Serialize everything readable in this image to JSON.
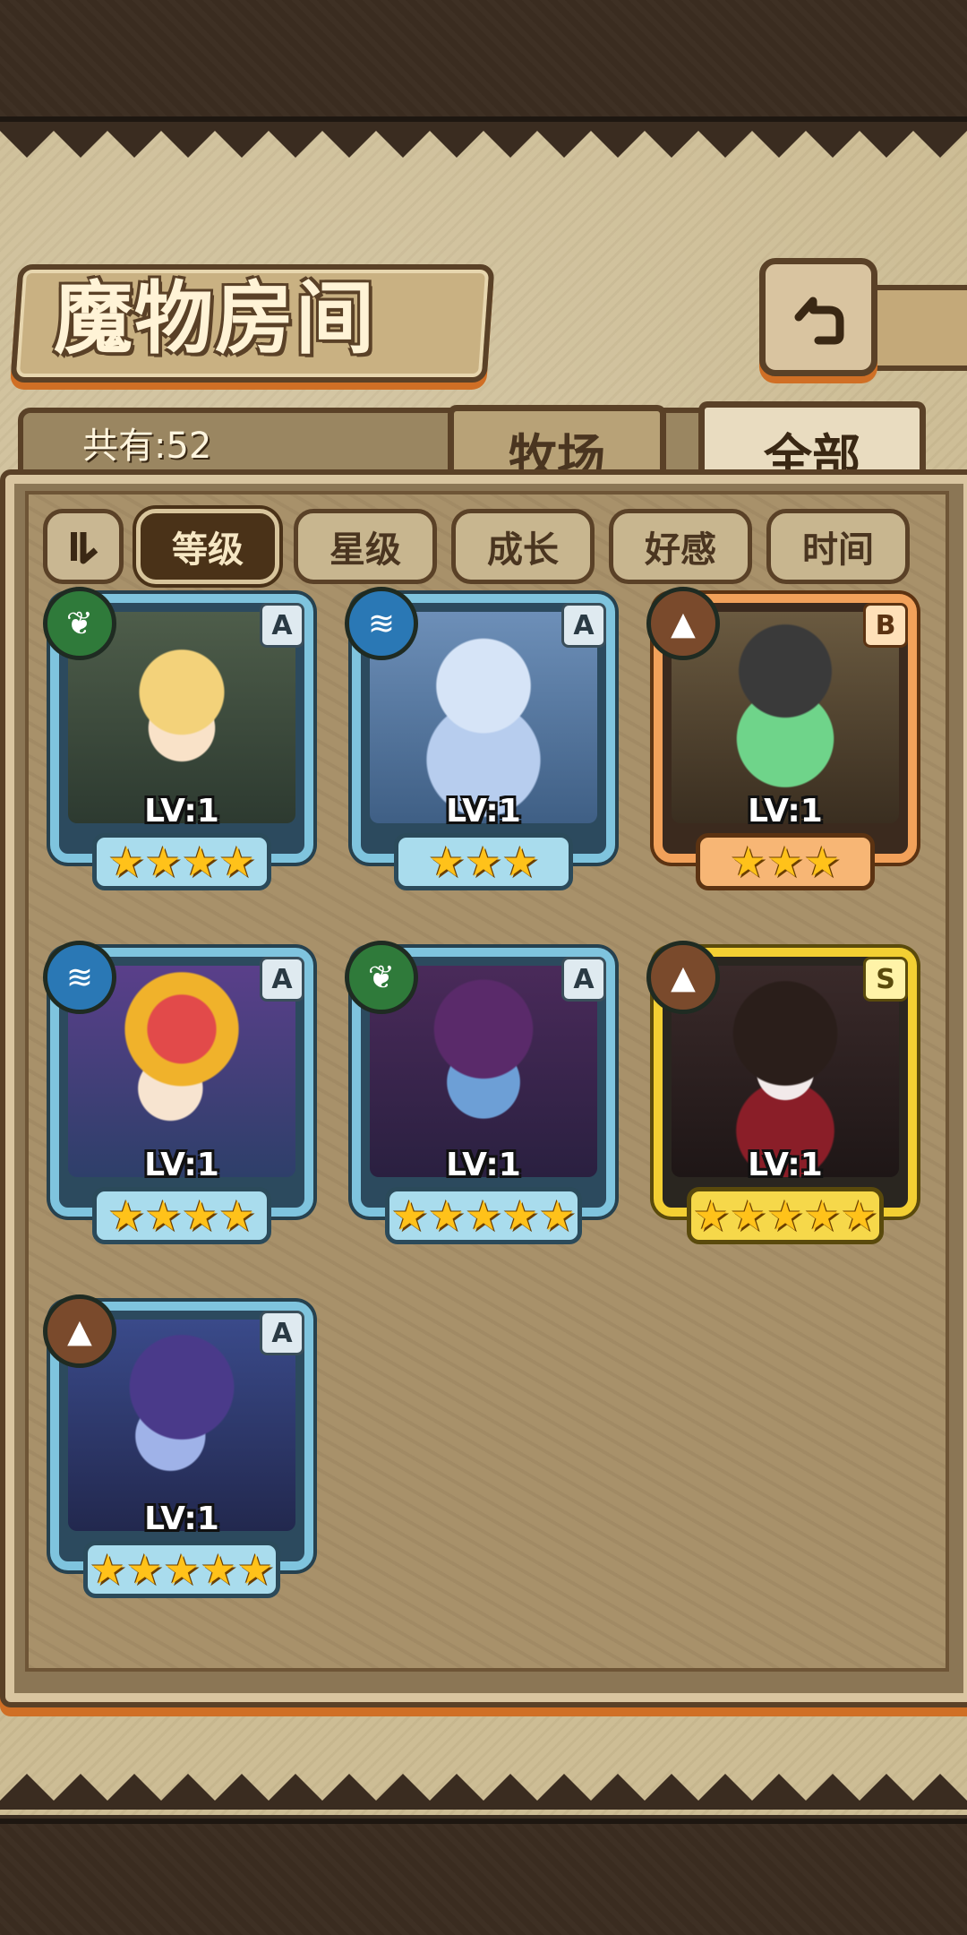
{
  "header": {
    "title": "魔物房间",
    "count_text": "共有:52"
  },
  "tabs": [
    {
      "label": "牧场",
      "active": false
    },
    {
      "label": "全部",
      "active": true
    }
  ],
  "filters": [
    {
      "label": "等级",
      "active": true
    },
    {
      "label": "星级",
      "active": false
    },
    {
      "label": "成长",
      "active": false
    },
    {
      "label": "好感",
      "active": false
    },
    {
      "label": "时间",
      "active": false
    }
  ],
  "colors": {
    "leaf": "#2f7a3a",
    "water": "#2a78b5",
    "earth": "#7a4a2c"
  },
  "monsters": [
    {
      "level": "LV:1",
      "rank": "A",
      "element": "leaf-icon",
      "stars": 4,
      "frame": "blue"
    },
    {
      "level": "LV:1",
      "rank": "A",
      "element": "water-icon",
      "stars": 3,
      "frame": "blue"
    },
    {
      "level": "LV:1",
      "rank": "B",
      "element": "earth-icon",
      "stars": 3,
      "frame": "orange"
    },
    {
      "level": "LV:1",
      "rank": "A",
      "element": "water-icon",
      "stars": 4,
      "frame": "blue"
    },
    {
      "level": "LV:1",
      "rank": "A",
      "element": "leaf-icon",
      "stars": 5,
      "frame": "blue"
    },
    {
      "level": "LV:1",
      "rank": "S",
      "element": "earth-icon",
      "stars": 5,
      "frame": "gold"
    },
    {
      "level": "LV:1",
      "rank": "A",
      "element": "earth-icon",
      "stars": 5,
      "frame": "blue"
    }
  ]
}
